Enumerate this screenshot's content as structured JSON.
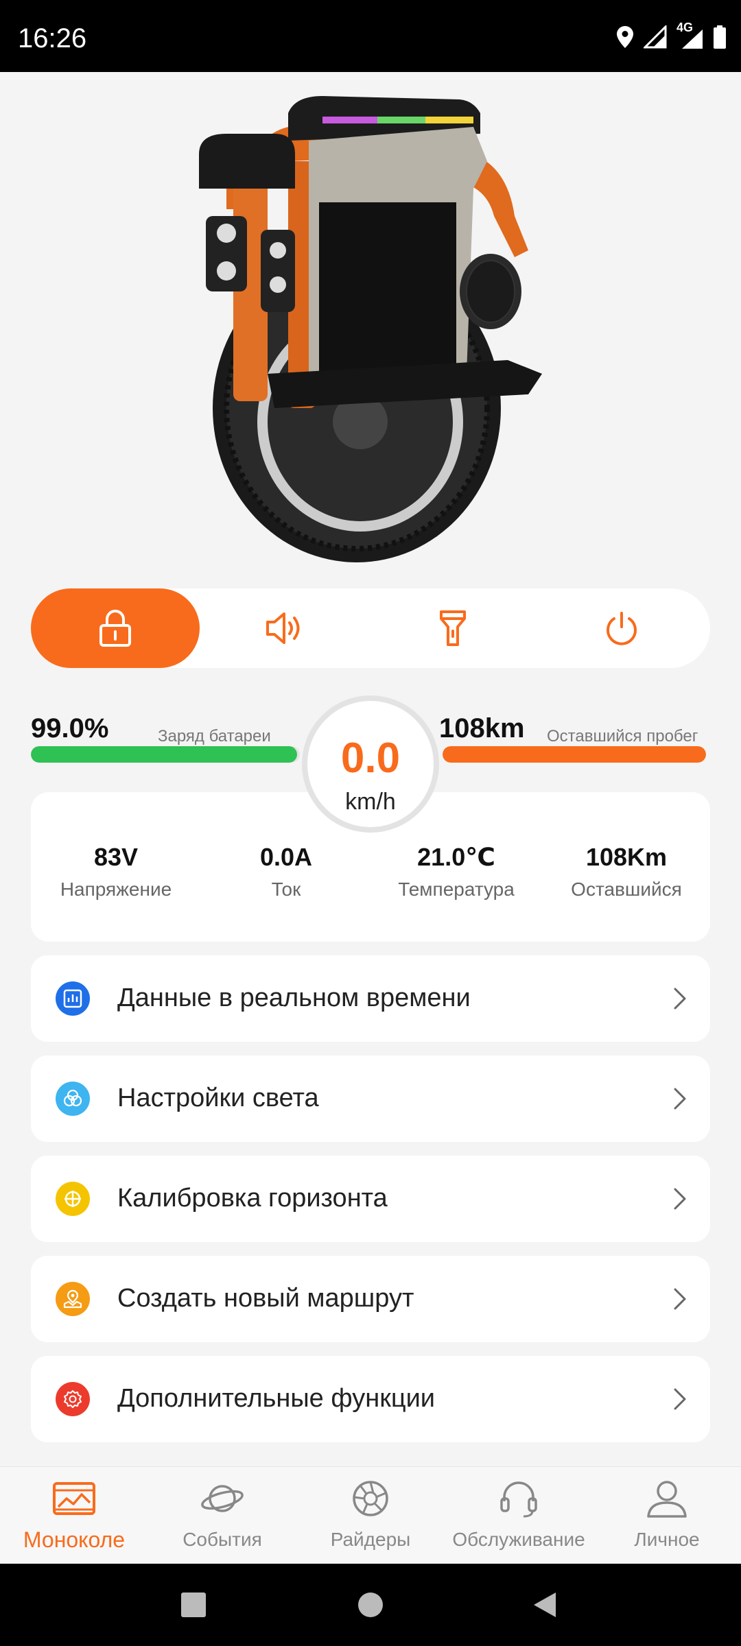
{
  "status": {
    "time": "16:26",
    "network": "4G"
  },
  "controls": [
    {
      "name": "lock",
      "icon": "lock-icon",
      "active": true
    },
    {
      "name": "horn",
      "icon": "speaker-icon",
      "active": false
    },
    {
      "name": "light",
      "icon": "flashlight-icon",
      "active": false
    },
    {
      "name": "power",
      "icon": "power-icon",
      "active": false
    }
  ],
  "battery": {
    "value": "99.0%",
    "label": "Заряд батареи",
    "level": 0.99,
    "color": "#2fc153"
  },
  "range": {
    "value": "108km",
    "label": "Оставшийся пробег",
    "level": 1.0,
    "color": "#f86b1c"
  },
  "speed": {
    "value": "0.0",
    "unit": "km/h"
  },
  "metrics": [
    {
      "value": "83V",
      "label": "Напряжение"
    },
    {
      "value": "0.0A",
      "label": "Ток"
    },
    {
      "value": "21.0℃",
      "label": "Температура"
    },
    {
      "value": "108Km",
      "label": "Оставшийся"
    }
  ],
  "menu": [
    {
      "label": "Данные в реальном времени",
      "icon": "chart-icon",
      "color": "#1e6fe8"
    },
    {
      "label": "Настройки света",
      "icon": "rgb-circles-icon",
      "color": "#3eb4f0"
    },
    {
      "label": "Калибровка горизонта",
      "icon": "crosshair-icon",
      "color": "#f5c400"
    },
    {
      "label": "Создать новый маршрут",
      "icon": "map-route-icon",
      "color": "#f59b14"
    },
    {
      "label": "Дополнительные функции",
      "icon": "gear-icon",
      "color": "#ec3b2c"
    }
  ],
  "nav": [
    {
      "label": "Моноколе",
      "icon": "wheel-card-icon",
      "active": true
    },
    {
      "label": "События",
      "icon": "planet-icon",
      "active": false
    },
    {
      "label": "Райдеры",
      "icon": "aperture-icon",
      "active": false
    },
    {
      "label": "Обслуживание",
      "icon": "headset-icon",
      "active": false
    },
    {
      "label": "Личное",
      "icon": "person-icon",
      "active": false
    }
  ],
  "colors": {
    "accent": "#f86b1c",
    "battery": "#2fc153",
    "background": "#f4f4f4"
  }
}
